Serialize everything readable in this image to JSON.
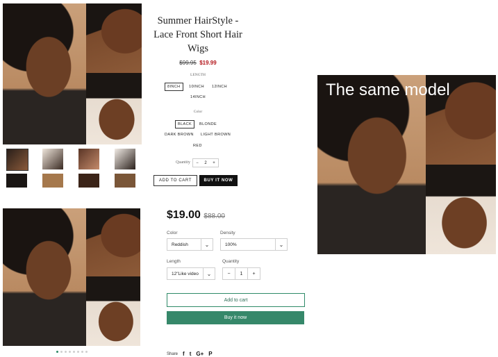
{
  "top_product": {
    "title": "Summer HairStyle - Lace Front Short Hair Wigs",
    "price_old": "$99.95",
    "price_new": "$19.99",
    "length_label": "LENGTH",
    "length_options": [
      "8INCH",
      "10INCH",
      "12INCH",
      "14INCH"
    ],
    "length_selected": "8INCH",
    "color_label": "Color",
    "color_options": [
      "BLACK",
      "BLONDE",
      "DARK BROWN",
      "LIGHT BROWN",
      "RED"
    ],
    "color_selected": "BLACK",
    "quantity_label": "Quantity",
    "quantity_value": "2",
    "minus": "−",
    "plus": "+",
    "add_to_cart": "ADD TO CART",
    "buy_it_now": "BUY IT NOW"
  },
  "bottom_product": {
    "price": "$19.00",
    "price_old": "$88.00",
    "color_label": "Color",
    "color_value": "Reddish",
    "density_label": "Density",
    "density_value": "100%",
    "length_label": "Length",
    "length_value": "12\"Like video",
    "quantity_label": "Quantity",
    "quantity_value": "1",
    "minus": "−",
    "plus": "+",
    "add_to_cart": "Add to cart",
    "buy_it_now": "Buy it now",
    "share_label": "Share",
    "carousel_dots": 8,
    "carousel_active": 0
  },
  "comparison": {
    "caption": "The same model"
  },
  "icons": {
    "facebook": "f",
    "twitter": "t",
    "google": "G+",
    "pinterest": "P",
    "chevron": "⌄"
  }
}
